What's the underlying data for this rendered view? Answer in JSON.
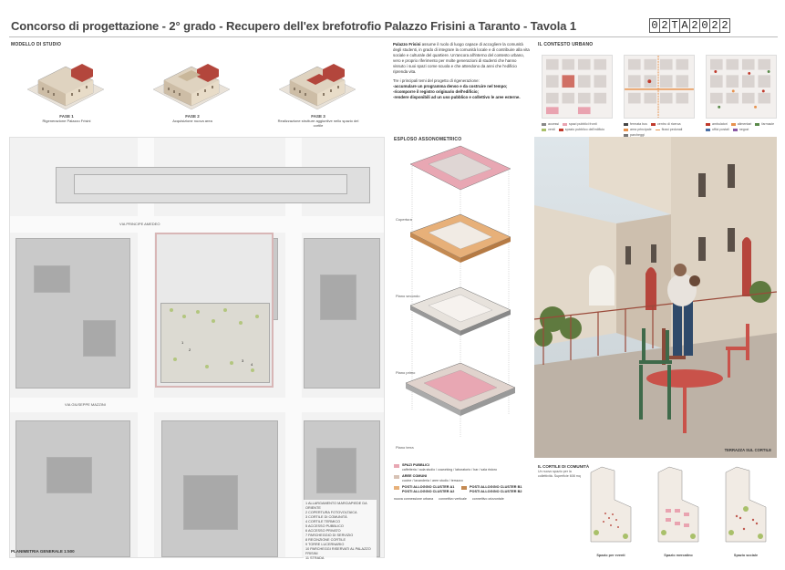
{
  "header": {
    "title": "Concorso di progettazione - 2° grado - Recupero dell'ex brefotrofio Palazzo Frisini a Taranto - Tavola 1",
    "code": [
      "0",
      "2",
      "T",
      "A",
      "2",
      "0",
      "2",
      "2"
    ]
  },
  "models": {
    "label": "MODELLO DI STUDIO",
    "phases": [
      {
        "title": "FASE 1",
        "text": "Rigenerazione Palazzo Frisini"
      },
      {
        "title": "FASE 2",
        "text": "Acquisizione nuova area"
      },
      {
        "title": "FASE 3",
        "text": "Realizzazione strutture aggiuntive nello spazio del cortile"
      }
    ]
  },
  "intro": {
    "p1_lead": "Palazzo Frisini",
    "p1": " assume il ruolo di luogo capace di accogliere la comunità degli studenti, in grado di integrare la comunità locale e di contribuire alla vita sociale e culturale del quartiere. Un'ancora all'interno del contesto urbano, vero e proprio riferimento per molte generazioni di studenti che hanno vissuto i suoi spazi come scuola e che attendono da anni che l'edificio riprenda vita.",
    "p2_lead": "Tre i principali temi del progetto di rigenerazione:",
    "p2_items": [
      "-accumulare un programma denso e da costruire nel tempo;",
      "-ricomporre il registro originario dell'edificio;",
      "-rendere disponibili ad un uso pubblico e collettivo le aree esterne."
    ]
  },
  "context": {
    "label": "IL CONTESTO URBANO",
    "legend_1": [
      "accessi",
      "spazi pubblici fronti",
      "verdi",
      "spazio pubblico dell'edificio"
    ],
    "legend_2": [
      "fermata bus",
      "centro di ricerca",
      "area principale",
      "flussi pedonali",
      "parcheggi"
    ],
    "legend_3": [
      "ambulatori",
      "alimentari",
      "farmacie",
      "uffici postali",
      "negozi"
    ]
  },
  "masterplan": {
    "label": "PLANIMETRIA GENERALE 1:500",
    "street_1": "VIA PRINCIPE AMEDEO",
    "street_2": "VIA GIUSEPPE MAZZINI",
    "legend": [
      "1  ALLARGAMENTO MARCIAPIEDE DA ORIENTE",
      "2  COPERTURA FOTOVOLTAICA",
      "3  CORTILE DI COMUNITÀ",
      "4  CORTILE TERMICO",
      "5  ACCESSO PUBBLICO",
      "6  ACCESSO PRIVATO",
      "7  PARCHEGGIO DI SERVIZIO",
      "8  RECINZIONE CORTILE",
      "9  TORRE LUCERNARIO",
      "10 PARCHEGGI RISERVATI AL PALAZZO FRISINI",
      "11 STRADA"
    ],
    "num_1": "1",
    "num_2": "2",
    "num_3": "3",
    "num_4": "4"
  },
  "axo": {
    "label": "ESPLOSO ASSONOMETRICO",
    "levels": [
      "Copertura",
      "Piano secondo",
      "Piano primo",
      "Piano terra"
    ],
    "legend": {
      "public_title": "SPAZI PUBBLICI",
      "public_items": "caffetteria / aula studio / coworking / laboratorio / bar / sala ristoro",
      "common_title": "AREE COMUNI",
      "common_items": "cucine / lavanderia / aree studio / terrazzo",
      "cluster_a1": "POSTI ALLOGGIO CLUSTER A1",
      "cluster_a2": "POSTI ALLOGGIO CLUSTER A2",
      "cluster_b1": "POSTI ALLOGGIO CLUSTER B1",
      "cluster_b2": "POSTI ALLOGGIO CLUSTER B2",
      "line_1": "nuova connessione urbana",
      "line_2": "connettivo verticale",
      "line_3": "connettivo orizzontale"
    },
    "colors": {
      "public": "#e8a7b3",
      "common": "#d7c2b4",
      "cluster_a": "#e7b079",
      "cluster_b": "#c48a52"
    }
  },
  "render": {
    "caption": "TERRAZZA SUL CORTILE"
  },
  "cortile": {
    "label": "IL CORTILE DI COMUNITÀ",
    "sub": "Un nuovo spazio per la collettività. Superficie 608 mq",
    "captions": [
      "Spazio per eventi",
      "Spazio mercatino",
      "Spazio sociale"
    ]
  }
}
